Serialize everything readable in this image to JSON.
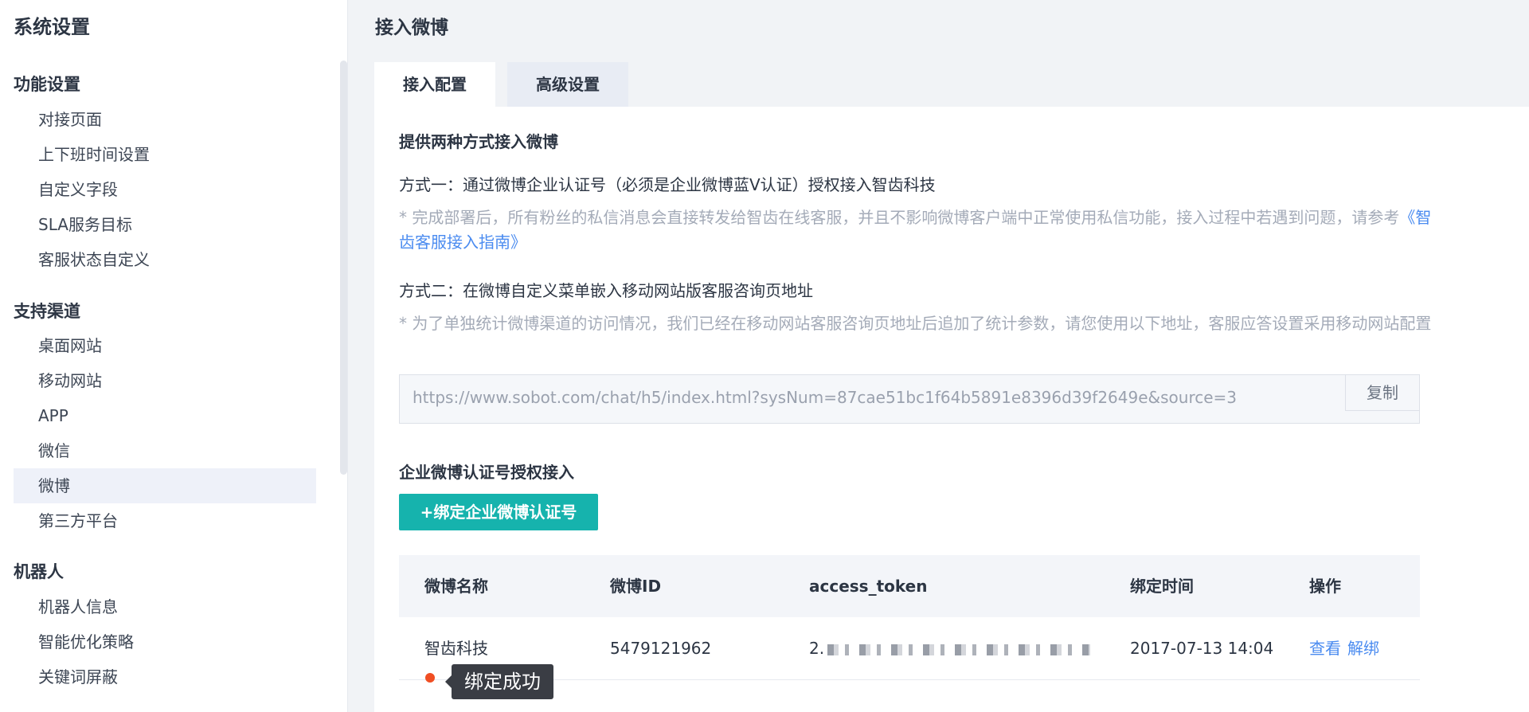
{
  "sidebar": {
    "title": "系统设置",
    "groups": [
      {
        "title": "功能设置",
        "items": [
          "对接页面",
          "上下班时间设置",
          "自定义字段",
          "SLA服务目标",
          "客服状态自定义"
        ]
      },
      {
        "title": "支持渠道",
        "items": [
          "桌面网站",
          "移动网站",
          "APP",
          "微信",
          "微博",
          "第三方平台"
        ]
      },
      {
        "title": "机器人",
        "items": [
          "机器人信息",
          "智能优化策略",
          "关键词屏蔽"
        ]
      }
    ],
    "active_item": "微博"
  },
  "main": {
    "title": "接入微博",
    "tabs": [
      "接入配置",
      "高级设置"
    ],
    "active_tab": "接入配置",
    "section_title": "提供两种方式接入微博",
    "method1": "方式一：通过微博企业认证号（必须是企业微博蓝V认证）授权接入智齿科技",
    "note1_text": "* 完成部署后，所有粉丝的私信消息会直接转发给智齿在线客服，并且不影响微博客户端中正常使用私信功能，接入过程中若遇到问题，请参考",
    "note1_link": "《智齿客服接入指南》",
    "method2": "方式二：在微博自定义菜单嵌入移动网站版客服咨询页地址",
    "note2": "* 为了单独统计微博渠道的访问情况，我们已经在移动网站客服咨询页地址后追加了统计参数，请您使用以下地址，客服应答设置采用移动网站配置",
    "url": "https://www.sobot.com/chat/h5/index.html?sysNum=87cae51bc1f64b5891e8396d39f2649e&source=3",
    "copy_label": "复制",
    "auth_title": "企业微博认证号授权接入",
    "bind_button": "+绑定企业微博认证号",
    "table": {
      "headers": [
        "微博名称",
        "微博ID",
        "access_token",
        "绑定时间",
        "操作"
      ],
      "rows": [
        {
          "name": "智齿科技",
          "id": "5479121962",
          "token_prefix": "2.",
          "time": "2017-07-13 14:04",
          "actions": [
            "查看",
            "解绑"
          ]
        }
      ]
    },
    "tooltip": "绑定成功"
  },
  "colors": {
    "accent": "#16b3ad",
    "link": "#4a8bf0",
    "status_dot": "#f04e23",
    "tooltip_bg": "#3a3d44"
  }
}
